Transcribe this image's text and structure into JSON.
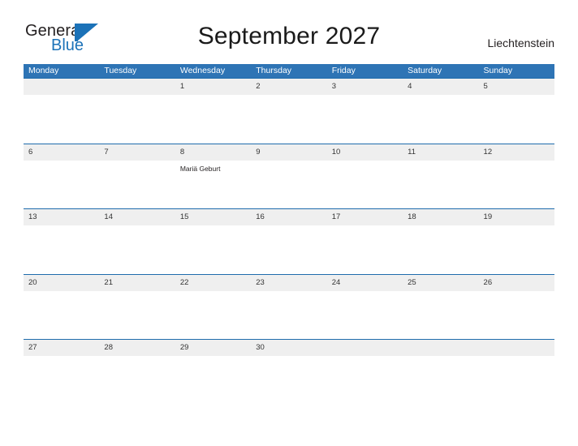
{
  "brand": {
    "name_part1": "General",
    "name_part2": "Blue",
    "mark": "triangle-logo"
  },
  "header": {
    "title": "September 2027",
    "country": "Liechtenstein"
  },
  "calendar": {
    "weekdays": [
      "Monday",
      "Tuesday",
      "Wednesday",
      "Thursday",
      "Friday",
      "Saturday",
      "Sunday"
    ],
    "colors": {
      "header_blue": "#2e74b5",
      "row_rule_blue": "#1f6cac",
      "date_strip_gray": "#efefef",
      "brand_blue": "#1b72b8",
      "text_dark": "#231f20"
    },
    "weeks": [
      [
        {
          "day": "",
          "events": []
        },
        {
          "day": "",
          "events": []
        },
        {
          "day": "1",
          "events": []
        },
        {
          "day": "2",
          "events": []
        },
        {
          "day": "3",
          "events": []
        },
        {
          "day": "4",
          "events": []
        },
        {
          "day": "5",
          "events": []
        }
      ],
      [
        {
          "day": "6",
          "events": []
        },
        {
          "day": "7",
          "events": []
        },
        {
          "day": "8",
          "events": [
            "Mariä Geburt"
          ]
        },
        {
          "day": "9",
          "events": []
        },
        {
          "day": "10",
          "events": []
        },
        {
          "day": "11",
          "events": []
        },
        {
          "day": "12",
          "events": []
        }
      ],
      [
        {
          "day": "13",
          "events": []
        },
        {
          "day": "14",
          "events": []
        },
        {
          "day": "15",
          "events": []
        },
        {
          "day": "16",
          "events": []
        },
        {
          "day": "17",
          "events": []
        },
        {
          "day": "18",
          "events": []
        },
        {
          "day": "19",
          "events": []
        }
      ],
      [
        {
          "day": "20",
          "events": []
        },
        {
          "day": "21",
          "events": []
        },
        {
          "day": "22",
          "events": []
        },
        {
          "day": "23",
          "events": []
        },
        {
          "day": "24",
          "events": []
        },
        {
          "day": "25",
          "events": []
        },
        {
          "day": "26",
          "events": []
        }
      ],
      [
        {
          "day": "27",
          "events": []
        },
        {
          "day": "28",
          "events": []
        },
        {
          "day": "29",
          "events": []
        },
        {
          "day": "30",
          "events": []
        },
        {
          "day": "",
          "events": []
        },
        {
          "day": "",
          "events": []
        },
        {
          "day": "",
          "events": []
        }
      ]
    ]
  }
}
